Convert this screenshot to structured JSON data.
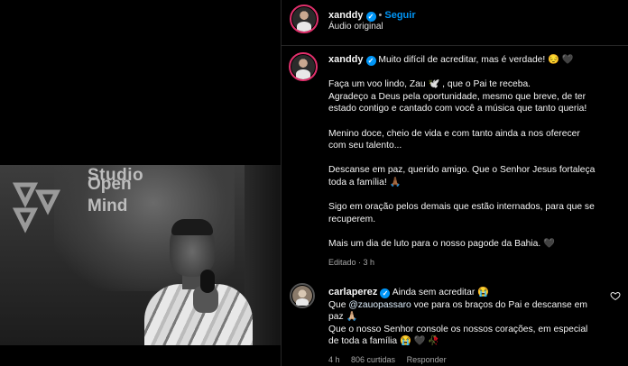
{
  "header": {
    "username": "xanddy",
    "separator": "•",
    "follow_label": "Seguir",
    "subtitle": "Áudio original"
  },
  "caption": {
    "username": "xanddy",
    "line1": "Muito difícil de acreditar, mas é verdade! 😔 🖤",
    "p1": [
      "Faça um voo lindo, Zau 🕊️ , que o Pai te receba.",
      "Agradeço a Deus pela oportunidade, mesmo que breve, de ter",
      "estado contigo e cantado com você a música que tanto queria!"
    ],
    "p2": [
      "Menino doce, cheio de vida e com tanto ainda a nos oferecer",
      "com seu talento..."
    ],
    "p3": [
      "Descanse em paz, querido amigo. Que o Senhor Jesus fortaleça",
      "toda a família! 🙏🏾"
    ],
    "p4": [
      "Sigo em oração pelos demais que estão internados, para que se",
      "recuperem."
    ],
    "p5": "Mais um dia de luto para o nosso pagode da Bahia. 🖤",
    "meta": "Editado · 3 h"
  },
  "comment": {
    "username": "carlaperez",
    "text_first": "Ainda sem acreditar 😭",
    "mention": "@zauopassaro",
    "text_after_mention": " voe para os braços do Pai e descanse em",
    "line3": "paz 🙏🏼",
    "line4": "Que o nosso Senhor console os nossos corações, em especial",
    "line5": "de toda a família 😭 🖤 🥀",
    "time": "4 h",
    "likes": "806 curtidas",
    "reply_label": "Responder"
  },
  "video": {
    "wall_text_top": "Studio",
    "wall_text_open": "Open",
    "wall_text_mind": "Mind"
  },
  "colors": {
    "accent_blue": "#0095f6",
    "background": "#000000",
    "muted_text": "#a8a8a8"
  }
}
